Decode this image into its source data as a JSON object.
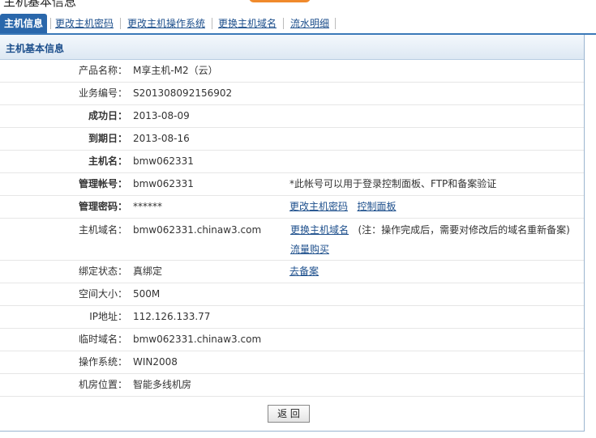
{
  "page_title": "主机基本信息",
  "tabs": [
    {
      "label": "主机信息",
      "active": true
    },
    {
      "label": "更改主机密码"
    },
    {
      "label": "更改主机操作系统"
    },
    {
      "label": "更换主机域名"
    },
    {
      "label": "流水明细"
    }
  ],
  "panel_title": "主机基本信息",
  "rows": {
    "product": {
      "label": "产品名称：",
      "value": "M享主机-M2（云）"
    },
    "order": {
      "label": "业务编号：",
      "value": "S201308092156902"
    },
    "success_date": {
      "label": "成功日：",
      "value": "2013-08-09"
    },
    "expire_date": {
      "label": "到期日：",
      "value": "2013-08-16"
    },
    "host_name": {
      "label": "主机名：",
      "value": "bmw062331"
    },
    "admin_account": {
      "label": "管理帐号：",
      "value": "bmw062331",
      "note": "*此帐号可以用于登录控制面板、FTP和备案验证"
    },
    "admin_password": {
      "label": "管理密码：",
      "value": "******",
      "link1": "更改主机密码",
      "link2": "控制面板"
    },
    "domain": {
      "label": "主机域名：",
      "value": "bmw062331.chinaw3.com",
      "link": "更换主机域名",
      "note": "(注：操作完成后，需要对修改后的域名重新备案)",
      "link_buy": "流量购买"
    },
    "bind_status": {
      "label": "绑定状态：",
      "value": "真绑定",
      "link": "去备案"
    },
    "space": {
      "label": "空间大小：",
      "value": "500M"
    },
    "ip": {
      "label": "IP地址：",
      "value": "112.126.133.77"
    },
    "temp_domain": {
      "label": "临时域名：",
      "value": "bmw062331.chinaw3.com"
    },
    "os": {
      "label": "操作系统：",
      "value": "WIN2008"
    },
    "datacenter": {
      "label": "机房位置：",
      "value": "智能多线机房"
    }
  },
  "back_button": "返 回"
}
